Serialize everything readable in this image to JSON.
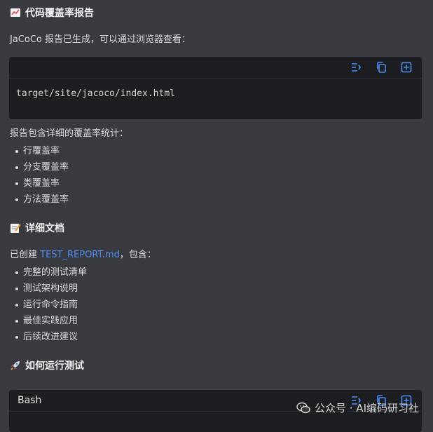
{
  "section_coverage": {
    "title": "代码覆盖率报告",
    "icon": "chart-icon"
  },
  "coverage_intro": "JaCoCo 报告已生成，可以通过浏览器查看：",
  "code_block_1": {
    "code": "target/site/jacoco/index.html",
    "icons": [
      "wrap-icon",
      "copy-icon",
      "add-icon"
    ]
  },
  "stats_intro": "报告包含详细的覆盖率统计：",
  "stats_items": [
    "行覆盖率",
    "分支覆盖率",
    "类覆盖率",
    "方法覆盖率"
  ],
  "section_docs": {
    "title": "详细文档",
    "icon": "memo-icon"
  },
  "docs_intro_prefix": "已创建 ",
  "docs_link": "TEST_REPORT.md",
  "docs_intro_suffix": "，包含：",
  "docs_items": [
    "完整的测试清单",
    "测试架构说明",
    "运行命令指南",
    "最佳实践应用",
    "后续改进建议"
  ],
  "section_run": {
    "title": "如何运行测试",
    "icon": "rocket-icon"
  },
  "code_block_2": {
    "lang": "Bash",
    "icons": [
      "wrap-icon",
      "copy-icon",
      "add-icon"
    ]
  },
  "watermark": "公众号 · AI编码研习社",
  "colors": {
    "accent": "#4f8ef7",
    "background": "#3a3b40",
    "code_bg": "#1d1e22"
  }
}
